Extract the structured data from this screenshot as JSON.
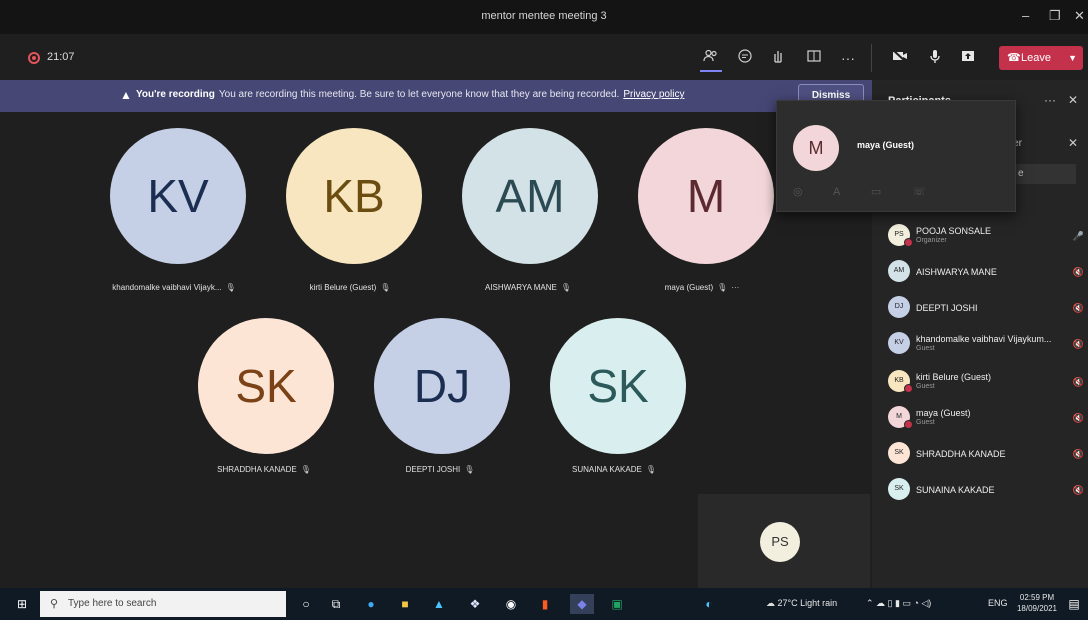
{
  "window": {
    "title": "mentor mentee meeting 3",
    "minimize": "–",
    "restore": "❐",
    "close": "✕"
  },
  "toolbar": {
    "timer": "21:07",
    "icons": [
      "people-icon",
      "chat-icon",
      "raise-hand-icon",
      "rooms-icon",
      "more-icon",
      "camera-off-icon",
      "mic-icon",
      "share-icon"
    ],
    "leave_label": "Leave"
  },
  "banner": {
    "bold": "You're recording",
    "message": "You are recording this meeting. Be sure to let everyone know that they are being recorded.",
    "link": "Privacy policy",
    "dismiss": "Dismiss"
  },
  "tiles": [
    {
      "initials": "KV",
      "name": "khandomalke vaibhavi Vijayk...",
      "bg": "#c5d0e6",
      "fg": "#1b2e52"
    },
    {
      "initials": "KB",
      "name": "kirti Belure (Guest)",
      "bg": "#f7e6bf",
      "fg": "#6b4d12"
    },
    {
      "initials": "AM",
      "name": "AISHWARYA MANE",
      "bg": "#d3e2e6",
      "fg": "#2b4a54"
    },
    {
      "initials": "M",
      "name": "maya (Guest)",
      "bg": "#f2d6d9",
      "fg": "#5a2a30"
    },
    {
      "initials": "SK",
      "name": "SHRADDHA KANADE",
      "bg": "#fde5d6",
      "fg": "#7a4216"
    },
    {
      "initials": "DJ",
      "name": "DEEPTI JOSHI",
      "bg": "#c5d0e6",
      "fg": "#1b2e52"
    },
    {
      "initials": "SK",
      "name": "SUNAINA KAKADE",
      "bg": "#d9eeee",
      "fg": "#2c5a5a"
    }
  ],
  "tile_more": "···",
  "selfview": {
    "initials": "PS"
  },
  "panel": {
    "title": "Participants",
    "more": "···",
    "close": "✕",
    "invite_partial": "nber",
    "search_partial": "e",
    "participants": [
      {
        "initials": "PS",
        "name": "POOJA SONSALE",
        "sub": "Organizer",
        "bg": "#f3efdf",
        "status": "#c4314b",
        "mic": "🎤"
      },
      {
        "initials": "AM",
        "name": "AISHWARYA MANE",
        "sub": "",
        "bg": "#d3e2e6",
        "status": "",
        "mic": "🔇"
      },
      {
        "initials": "DJ",
        "name": "DEEPTI JOSHI",
        "sub": "",
        "bg": "#c5d0e6",
        "status": "",
        "mic": "🔇"
      },
      {
        "initials": "KV",
        "name": "khandomalke vaibhavi Vijaykum...",
        "sub": "Guest",
        "bg": "#c5d0e6",
        "status": "",
        "mic": "🔇"
      },
      {
        "initials": "KB",
        "name": "kirti Belure (Guest)",
        "sub": "Guest",
        "bg": "#f7e6bf",
        "status": "#c4314b",
        "mic": "🔇"
      },
      {
        "initials": "M",
        "name": "maya (Guest)",
        "sub": "Guest",
        "bg": "#f2d6d9",
        "status": "#c4314b",
        "mic": "🔇"
      },
      {
        "initials": "SK",
        "name": "SHRADDHA KANADE",
        "sub": "",
        "bg": "#fde5d6",
        "status": "",
        "mic": "🔇"
      },
      {
        "initials": "SK",
        "name": "SUNAINA KAKADE",
        "sub": "",
        "bg": "#d9eeee",
        "status": "",
        "mic": "🔇"
      }
    ]
  },
  "popup": {
    "initials": "M",
    "name": "maya (Guest)"
  },
  "taskbar": {
    "search_placeholder": "Type here to search",
    "weather": "27°C  Light rain",
    "lang": "ENG",
    "time": "02:59 PM",
    "date": "18/09/2021"
  }
}
